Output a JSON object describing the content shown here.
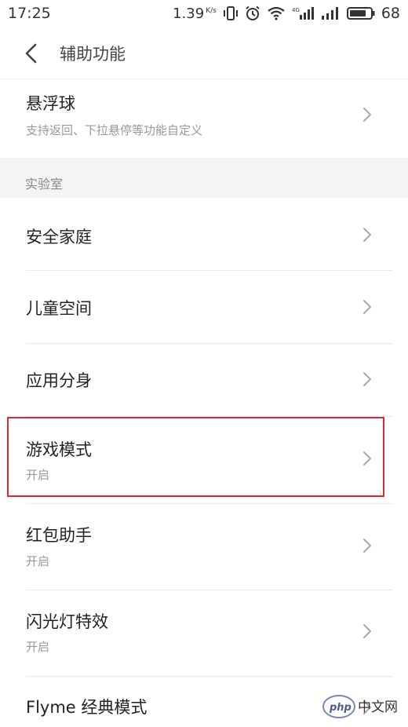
{
  "status_bar": {
    "time": "17:25",
    "network_speed": "1.39",
    "network_unit": "K/s",
    "battery": "68",
    "icons": [
      "vibrate-icon",
      "alarm-icon",
      "wifi-icon",
      "signal-4g-icon",
      "signal-icon",
      "battery-icon"
    ]
  },
  "header": {
    "title": "辅助功能",
    "back_icon": "back-arrow-icon"
  },
  "top_item": {
    "title": "悬浮球",
    "subtitle": "支持返回、下拉悬停等功能自定义"
  },
  "section": {
    "label": "实验室"
  },
  "items": [
    {
      "title": "安全家庭",
      "subtitle": ""
    },
    {
      "title": "儿童空间",
      "subtitle": ""
    },
    {
      "title": "应用分身",
      "subtitle": ""
    },
    {
      "title": "游戏模式",
      "subtitle": "开启"
    },
    {
      "title": "红包助手",
      "subtitle": "开启"
    },
    {
      "title": "闪光灯特效",
      "subtitle": "开启"
    },
    {
      "title": "Flyme 经典模式",
      "subtitle": ""
    }
  ],
  "annotation": {
    "highlight_color": "#e0262e"
  },
  "watermark": {
    "logo_text": "php",
    "site_text": "中文网"
  }
}
